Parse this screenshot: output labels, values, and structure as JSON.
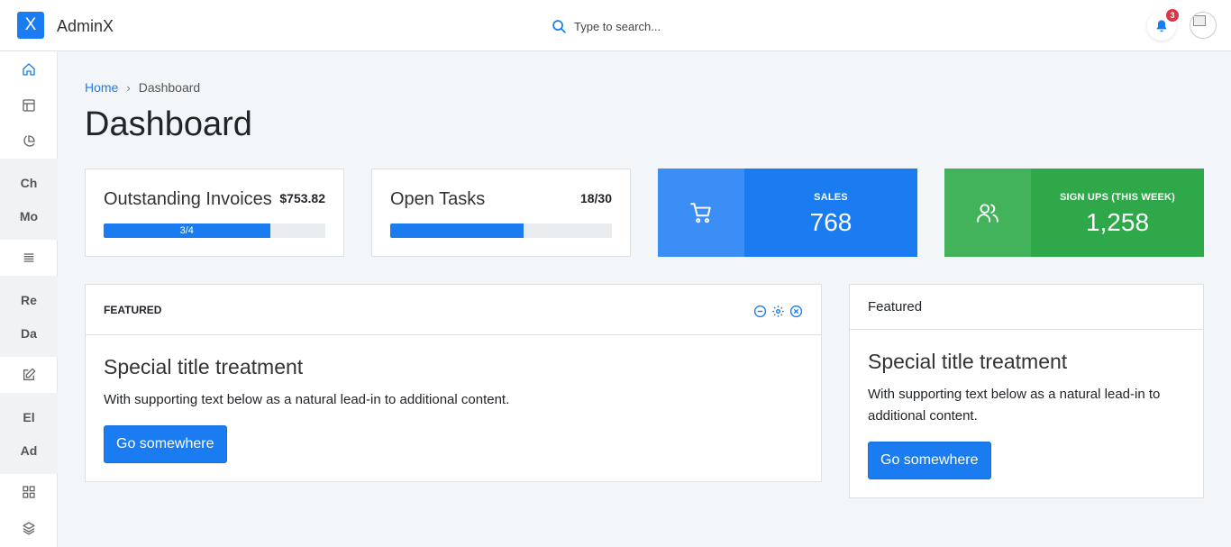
{
  "brand": {
    "logo": "X",
    "name": "AdminX"
  },
  "search": {
    "placeholder": "Type to search..."
  },
  "notifications": {
    "count": "3"
  },
  "sidebar": {
    "icons": [
      "home-icon",
      "layout-icon",
      "pie-chart-icon",
      "list-icon",
      "edit-icon",
      "grid-icon",
      "layers-icon"
    ],
    "text_items": [
      "Ch",
      "Mo",
      "Re",
      "Da",
      "El",
      "Ad"
    ],
    "accent": "#1a7cf0"
  },
  "breadcrumb": {
    "home": "Home",
    "separator": "›",
    "current": "Dashboard"
  },
  "page": {
    "title": "Dashboard"
  },
  "stats": [
    {
      "label": "Outstanding Invoices",
      "value": "$753.82",
      "progress_label": "3/4",
      "progress": 0.75
    },
    {
      "label": "Open Tasks",
      "value": "18/30",
      "progress_label": "",
      "progress": 0.6
    }
  ],
  "sales": {
    "caption": "SALES",
    "value": "768",
    "icon": "cart-icon",
    "color": "#1a7cf0",
    "icon_bg": "#3a8ef5"
  },
  "signups": {
    "caption": "SIGN UPS (THIS WEEK)",
    "value": "1,258",
    "icon": "users-icon",
    "color": "#2fa84a",
    "icon_bg": "#43b35b"
  },
  "featured_main": {
    "header": "FEATURED",
    "title": "Special title treatment",
    "text": "With supporting text below as a natural lead-in to additional content.",
    "button": "Go somewhere"
  },
  "featured_side": {
    "header": "Featured",
    "title": "Special title treatment",
    "text": "With supporting text below as a natural lead-in to additional content.",
    "button": "Go somewhere"
  }
}
